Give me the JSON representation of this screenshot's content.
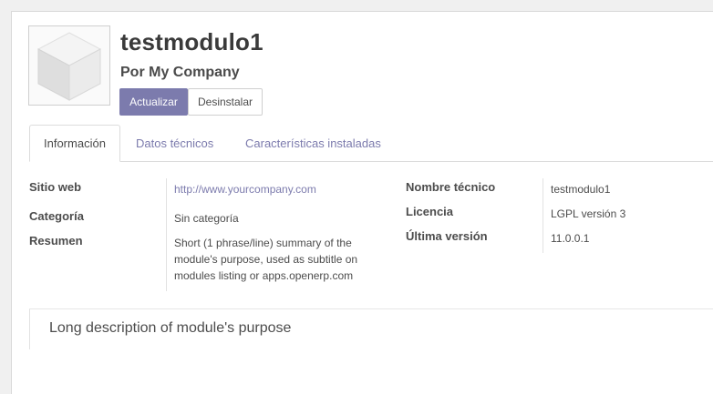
{
  "module": {
    "name": "testmodulo1",
    "author": "Por My Company",
    "logo_icon": "module-cube-icon"
  },
  "actions": {
    "upgrade_label": "Actualizar",
    "uninstall_label": "Desinstalar"
  },
  "tabs": [
    {
      "label": "Información",
      "active": true
    },
    {
      "label": "Datos técnicos",
      "active": false
    },
    {
      "label": "Características instaladas",
      "active": false
    }
  ],
  "info": {
    "website_label": "Sitio web",
    "website_value": "http://www.yourcompany.com",
    "category_label": "Categoría",
    "category_value": "Sin categoría",
    "summary_label": "Resumen",
    "summary_lines": [
      "Short (1 phrase/line) summary of the",
      "module's purpose, used as subtitle on",
      "modules listing or apps.openerp.com"
    ],
    "technical_name_label": "Nombre técnico",
    "technical_name_value": "testmodulo1",
    "license_label": "Licencia",
    "license_value": "LGPL versión 3",
    "latest_version_label": "Última versión",
    "latest_version_value": "11.0.0.1"
  },
  "description": "Long description of module's purpose",
  "colors": {
    "accent": "#7c7bad",
    "text": "#4c4c4c"
  }
}
